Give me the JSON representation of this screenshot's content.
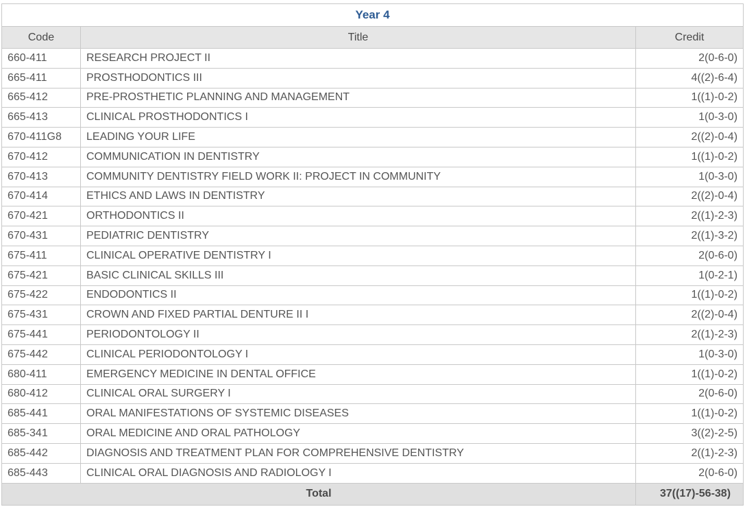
{
  "table": {
    "year_title": "Year 4",
    "headers": {
      "code": "Code",
      "title": "Title",
      "credit": "Credit"
    },
    "rows": [
      {
        "code": "660-411",
        "title": "RESEARCH PROJECT II",
        "credit": "2(0-6-0)"
      },
      {
        "code": "665-411",
        "title": "PROSTHODONTICS III",
        "credit": "4((2)-6-4)"
      },
      {
        "code": "665-412",
        "title": "PRE-PROSTHETIC PLANNING AND MANAGEMENT",
        "credit": "1((1)-0-2)"
      },
      {
        "code": "665-413",
        "title": "CLINICAL PROSTHODONTICS I",
        "credit": "1(0-3-0)"
      },
      {
        "code": "670-411G8",
        "title": "LEADING YOUR LIFE",
        "credit": "2((2)-0-4)"
      },
      {
        "code": "670-412",
        "title": "COMMUNICATION IN DENTISTRY",
        "credit": "1((1)-0-2)"
      },
      {
        "code": "670-413",
        "title": "COMMUNITY DENTISTRY FIELD WORK II: PROJECT IN COMMUNITY",
        "credit": "1(0-3-0)"
      },
      {
        "code": "670-414",
        "title": "ETHICS AND LAWS IN DENTISTRY",
        "credit": "2((2)-0-4)"
      },
      {
        "code": "670-421",
        "title": "ORTHODONTICS II",
        "credit": "2((1)-2-3)"
      },
      {
        "code": "670-431",
        "title": "PEDIATRIC DENTISTRY",
        "credit": "2((1)-3-2)"
      },
      {
        "code": "675-411",
        "title": "CLINICAL OPERATIVE DENTISTRY I",
        "credit": "2(0-6-0)"
      },
      {
        "code": "675-421",
        "title": "BASIC CLINICAL SKILLS III",
        "credit": "1(0-2-1)"
      },
      {
        "code": "675-422",
        "title": "ENDODONTICS II",
        "credit": "1((1)-0-2)"
      },
      {
        "code": "675-431",
        "title": "CROWN AND FIXED PARTIAL DENTURE II I",
        "credit": "2((2)-0-4)"
      },
      {
        "code": "675-441",
        "title": "PERIODONTOLOGY II",
        "credit": "2((1)-2-3)"
      },
      {
        "code": "675-442",
        "title": "CLINICAL PERIODONTOLOGY I",
        "credit": "1(0-3-0)"
      },
      {
        "code": "680-411",
        "title": "EMERGENCY MEDICINE IN DENTAL OFFICE",
        "credit": "1((1)-0-2)"
      },
      {
        "code": "680-412",
        "title": "CLINICAL ORAL SURGERY I",
        "credit": "2(0-6-0)"
      },
      {
        "code": "685-441",
        "title": "ORAL MANIFESTATIONS OF SYSTEMIC DISEASES",
        "credit": "1((1)-0-2)"
      },
      {
        "code": "685-341",
        "title": "ORAL MEDICINE AND ORAL PATHOLOGY",
        "credit": "3((2)-2-5)"
      },
      {
        "code": "685-442",
        "title": "DIAGNOSIS AND TREATMENT PLAN FOR COMPREHENSIVE DENTISTRY",
        "credit": "2((1)-2-3)"
      },
      {
        "code": "685-443",
        "title": "CLINICAL ORAL DIAGNOSIS AND RADIOLOGY I",
        "credit": "2(0-6-0)"
      }
    ],
    "total_label": "Total",
    "total_value": "37((17)-56-38)"
  },
  "colors": {
    "year_title": "#2e5c94",
    "header_bg": "#e6e6e6",
    "total_bg": "#e0e0e0",
    "border": "#c8c8c8",
    "text": "#555555"
  }
}
